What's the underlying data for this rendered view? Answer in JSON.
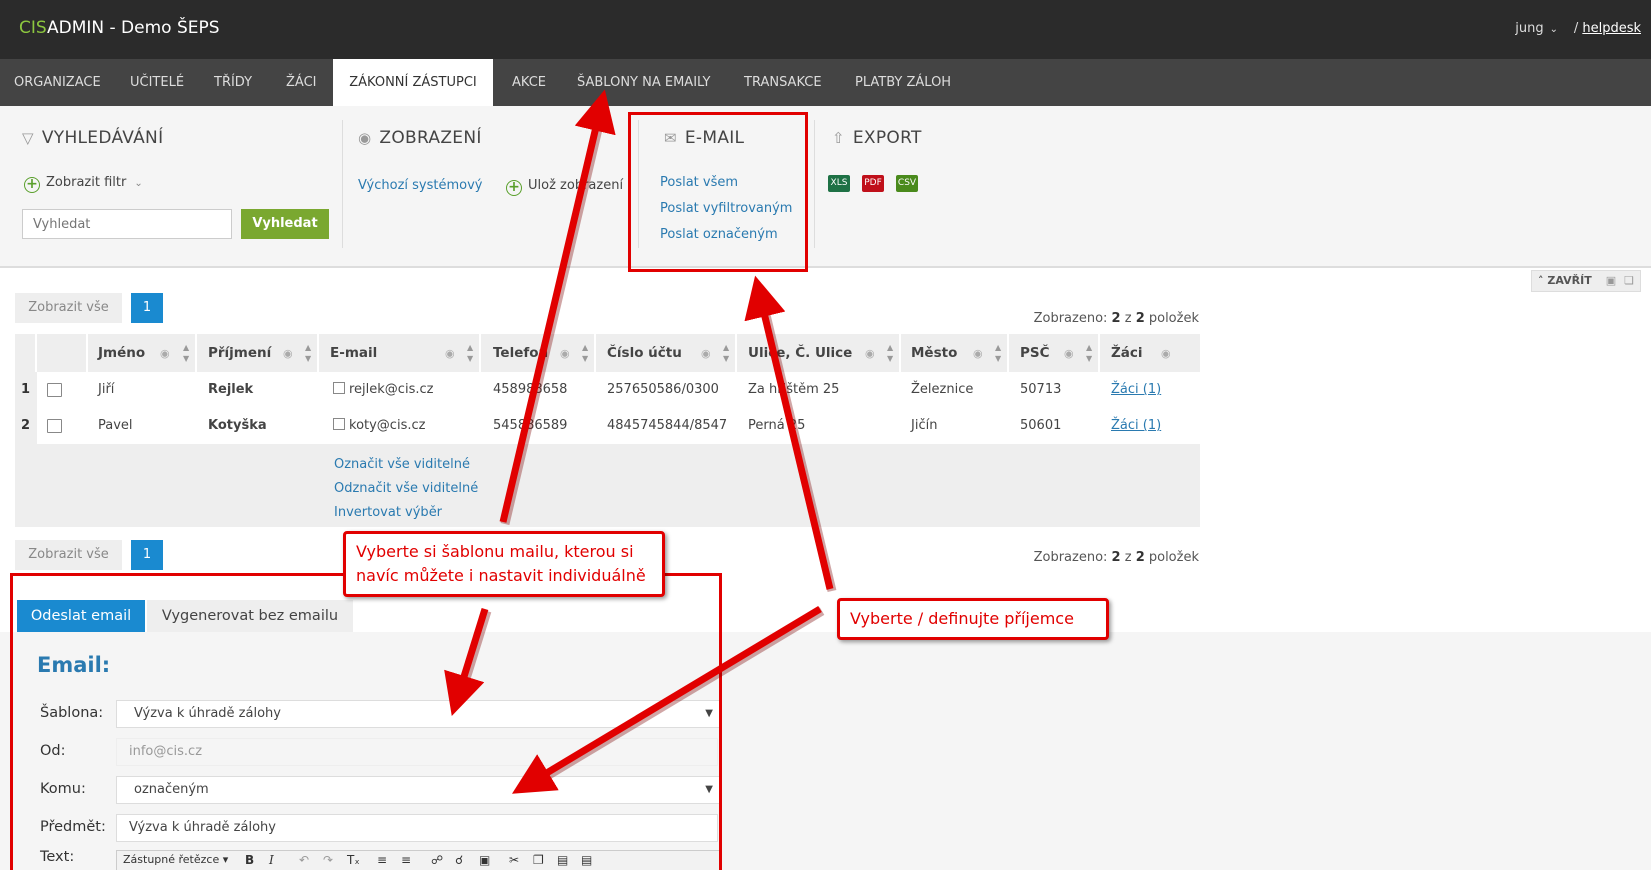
{
  "header": {
    "brand_prefix": "CIS",
    "brand_rest": "ADMIN - Demo ŠEPS",
    "user": "jung",
    "helpdesk_sep": "/ ",
    "helpdesk": "helpdesk"
  },
  "nav": {
    "items": [
      "Organizace",
      "Učitelé",
      "Třídy",
      "Žáci",
      "Zákonní zástupci",
      "Akce",
      "Šablony na emaily",
      "Transakce",
      "Platby záloh"
    ],
    "active": "Zákonní zástupci"
  },
  "panel": {
    "search": {
      "title": "Vyhledávání",
      "filter_label": "Zobrazit filtr",
      "placeholder": "Vyhledat",
      "button": "Vyhledat"
    },
    "view": {
      "title": "Zobrazení",
      "default_link": "Výchozí systémový",
      "save_label": "Ulož zobrazení"
    },
    "email": {
      "title": "E-mail",
      "send_all": "Poslat všem",
      "send_filtered": "Poslat vyfiltrovaným",
      "send_selected": "Poslat označeným"
    },
    "export": {
      "title": "Export",
      "formats": [
        "XLS",
        "PDF",
        "CSV"
      ],
      "colors": [
        "#1e7145",
        "#c0101a",
        "#4a8a1c"
      ]
    },
    "close_label": "ZAVŘÍT"
  },
  "pager": {
    "show_all": "Zobrazit vše",
    "page": "1",
    "count_prefix": "Zobrazeno: ",
    "shown": "2",
    "count_mid": " z ",
    "total": "2",
    "count_suffix": " položek"
  },
  "table": {
    "columns": [
      "Jméno",
      "Příjmení",
      "E-mail",
      "Telefon",
      "Číslo účtu",
      "Ulice, Č. Ulice",
      "Město",
      "PSČ",
      "Žáci"
    ],
    "rows": [
      {
        "num": "1",
        "first": "Jiří",
        "last": "Rejlek",
        "email": "rejlek@cis.cz",
        "phone": "458988658",
        "account": "257650586/0300",
        "street": "Za hřištěm 25",
        "city": "Železnice",
        "zip": "50713",
        "kids": "Žáci (1)"
      },
      {
        "num": "2",
        "first": "Pavel",
        "last": "Kotyška",
        "email": "koty@cis.cz",
        "phone": "545886589",
        "account": "4845745844/8547",
        "street": "Perná 25",
        "city": "Jičín",
        "zip": "50601",
        "kids": "Žáci (1)"
      }
    ],
    "footer_links": [
      "Označit vše viditelné",
      "Odznačit vše viditelné",
      "Invertovat výběr"
    ]
  },
  "form": {
    "tabs": [
      "Odeslat email",
      "Vygenerovat bez emailu"
    ],
    "heading": "Email:",
    "template_label": "Šablona:",
    "template_value": "Výzva k úhradě zálohy",
    "from_label": "Od:",
    "from_value": "info@cis.cz",
    "to_label": "Komu:",
    "to_value": "označeným",
    "subject_label": "Předmět:",
    "subject_value": "Výzva k úhradě zálohy",
    "text_label": "Text:",
    "toolbar_dropdown": "Zástupné řetězce"
  },
  "annotations": {
    "template_callout": "Vyberte si šablonu mailu, kterou si navíc můžete i nastavit individuálně",
    "recipients_callout": "Vyberte / definujte příjemce",
    "color": "#e10000"
  }
}
